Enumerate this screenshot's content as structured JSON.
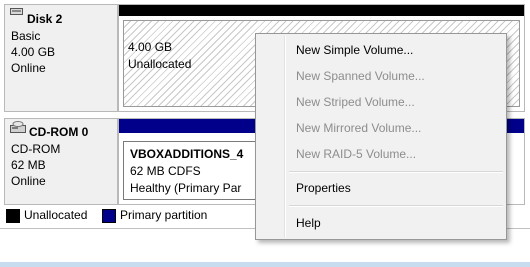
{
  "disks": [
    {
      "title": "Disk 2",
      "type": "Basic",
      "size": "4.00 GB",
      "status": "Online",
      "icon": "disk-icon",
      "volume": {
        "size": "4.00 GB",
        "state": "Unallocated"
      }
    },
    {
      "title": "CD-ROM 0",
      "type": "CD-ROM",
      "size": "62 MB",
      "status": "Online",
      "icon": "cd-rom-icon",
      "volume": {
        "name": "VBOXADDITIONS_4",
        "info": "62 MB CDFS",
        "state": "Healthy (Primary Par"
      }
    }
  ],
  "legend": [
    {
      "label": "Unallocated",
      "color": "#000000"
    },
    {
      "label": "Primary partition",
      "color": "#00008b"
    }
  ],
  "context_menu": {
    "items": [
      {
        "label": "New Simple Volume...",
        "enabled": true
      },
      {
        "label": "New Spanned Volume...",
        "enabled": false
      },
      {
        "label": "New Striped Volume...",
        "enabled": false
      },
      {
        "label": "New Mirrored Volume...",
        "enabled": false
      },
      {
        "label": "New RAID-5 Volume...",
        "enabled": false
      },
      {
        "label": "Properties",
        "enabled": true
      },
      {
        "label": "Help",
        "enabled": true
      }
    ]
  },
  "colors": {
    "unallocated_bar": "#000000",
    "primary_bar": "#00008b"
  }
}
